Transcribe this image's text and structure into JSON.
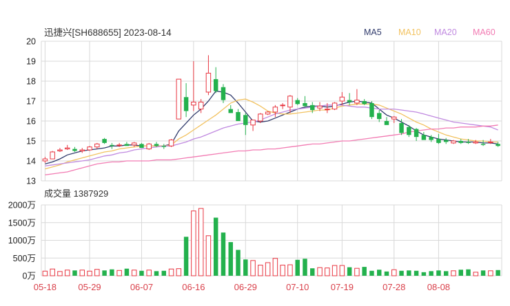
{
  "title": "迅捷兴[SH688655] 2023-08-14",
  "legend": [
    {
      "name": "MA5",
      "color": "#2f3a6b"
    },
    {
      "name": "MA10",
      "color": "#f2c260"
    },
    {
      "name": "MA20",
      "color": "#c089e0"
    },
    {
      "name": "MA60",
      "color": "#f27ab2"
    }
  ],
  "colors": {
    "up": "#e8343f",
    "down": "#23b14d",
    "grid": "#d8d8d8",
    "axis_text": "#222222",
    "date_text": "#d9404a",
    "vol_up_fill": "#ffffff"
  },
  "volume_label": "成交量 1387929",
  "chart_data": [
    {
      "type": "candlestick",
      "title": "迅捷兴[SH688655] 2023-08-14",
      "ylim": [
        13,
        20
      ],
      "yticks": [
        "13",
        "14",
        "15",
        "16",
        "17",
        "18",
        "19",
        "20"
      ],
      "x_tick_labels": [
        "05-18",
        "05-29",
        "06-07",
        "06-16",
        "06-29",
        "07-10",
        "07-19",
        "07-28",
        "08-08"
      ],
      "x_tick_index": [
        0,
        6,
        13,
        20,
        27,
        34,
        40,
        47,
        53
      ],
      "ohlc": [
        [
          14.0,
          14.2,
          13.9,
          14.1
        ],
        [
          14.1,
          14.5,
          14.1,
          14.45
        ],
        [
          14.5,
          14.65,
          14.45,
          14.55
        ],
        [
          14.6,
          14.8,
          14.55,
          14.65
        ],
        [
          14.6,
          14.7,
          14.45,
          14.5
        ],
        [
          14.5,
          14.65,
          14.4,
          14.55
        ],
        [
          14.55,
          14.75,
          14.5,
          14.7
        ],
        [
          14.7,
          14.9,
          14.6,
          14.85
        ],
        [
          15.1,
          15.15,
          14.85,
          14.9
        ],
        [
          14.8,
          14.9,
          14.6,
          14.75
        ],
        [
          14.8,
          14.9,
          14.7,
          14.8
        ],
        [
          14.85,
          14.95,
          14.75,
          14.75
        ],
        [
          14.8,
          14.95,
          14.7,
          14.9
        ],
        [
          14.85,
          14.9,
          14.65,
          14.65
        ],
        [
          14.6,
          14.9,
          14.55,
          14.85
        ],
        [
          14.85,
          14.95,
          14.7,
          14.75
        ],
        [
          14.75,
          14.85,
          14.6,
          14.7
        ],
        [
          14.75,
          15.1,
          14.7,
          15.05
        ],
        [
          16.1,
          18.1,
          16.1,
          18.1
        ],
        [
          17.2,
          17.9,
          16.2,
          16.5
        ],
        [
          16.8,
          19.0,
          16.5,
          16.95
        ],
        [
          16.6,
          17.1,
          16.4,
          16.95
        ],
        [
          17.45,
          19.3,
          17.3,
          18.4
        ],
        [
          18.1,
          18.7,
          17.4,
          17.5
        ],
        [
          17.7,
          17.85,
          16.9,
          17.05
        ],
        [
          16.6,
          16.8,
          16.4,
          16.4
        ],
        [
          16.45,
          16.6,
          16.0,
          16.0
        ],
        [
          16.3,
          16.4,
          15.3,
          15.8
        ],
        [
          15.8,
          16.0,
          15.5,
          16.05
        ],
        [
          16.0,
          16.4,
          15.9,
          16.35
        ],
        [
          16.35,
          16.5,
          16.3,
          16.45
        ],
        [
          16.45,
          16.8,
          16.2,
          16.7
        ],
        [
          16.8,
          16.9,
          16.6,
          16.8
        ],
        [
          16.7,
          17.3,
          16.4,
          17.25
        ],
        [
          17.05,
          17.15,
          16.8,
          16.85
        ],
        [
          16.9,
          17.25,
          16.7,
          16.75
        ],
        [
          16.8,
          16.95,
          16.4,
          16.55
        ],
        [
          16.65,
          16.95,
          16.5,
          16.75
        ],
        [
          16.6,
          16.9,
          16.4,
          16.6
        ],
        [
          16.6,
          16.95,
          16.55,
          16.9
        ],
        [
          17.0,
          17.45,
          16.8,
          17.2
        ],
        [
          17.05,
          17.4,
          16.8,
          16.95
        ],
        [
          16.9,
          17.6,
          16.8,
          17.05
        ],
        [
          17.0,
          17.1,
          16.8,
          16.85
        ],
        [
          16.9,
          17.0,
          16.1,
          16.2
        ],
        [
          16.4,
          16.55,
          15.95,
          16.1
        ],
        [
          16.0,
          16.2,
          15.8,
          15.8
        ],
        [
          16.1,
          16.25,
          15.9,
          16.2
        ],
        [
          15.9,
          16.1,
          15.3,
          15.4
        ],
        [
          15.7,
          15.8,
          15.2,
          15.3
        ],
        [
          15.6,
          15.65,
          15.0,
          15.2
        ],
        [
          15.3,
          15.45,
          15.05,
          15.05
        ],
        [
          15.2,
          15.3,
          14.95,
          15.05
        ],
        [
          15.1,
          15.35,
          14.85,
          14.9
        ],
        [
          15.05,
          15.15,
          14.85,
          14.95
        ],
        [
          14.9,
          15.05,
          14.85,
          15.0
        ],
        [
          15.0,
          15.1,
          14.85,
          14.9
        ],
        [
          14.95,
          15.1,
          14.85,
          14.9
        ],
        [
          14.9,
          15.05,
          14.85,
          14.95
        ],
        [
          14.85,
          15.05,
          14.75,
          14.8
        ],
        [
          14.95,
          15.1,
          14.85,
          14.95
        ],
        [
          14.85,
          14.95,
          14.7,
          14.75
        ]
      ],
      "ma": {
        "MA5": [
          13.85,
          13.95,
          14.1,
          14.3,
          14.4,
          14.5,
          14.55,
          14.6,
          14.65,
          14.75,
          14.75,
          14.8,
          14.8,
          14.75,
          14.75,
          14.75,
          14.75,
          14.85,
          15.5,
          15.9,
          16.3,
          16.6,
          17.0,
          17.5,
          17.45,
          17.3,
          16.9,
          16.45,
          16.0,
          15.95,
          16.0,
          16.15,
          16.3,
          16.45,
          16.6,
          16.7,
          16.75,
          16.75,
          16.7,
          16.75,
          16.85,
          16.95,
          17.0,
          16.95,
          16.9,
          16.6,
          16.3,
          16.15,
          15.95,
          15.75,
          15.5,
          15.3,
          15.2,
          15.1,
          15.05,
          15.0,
          14.95,
          14.95,
          14.95,
          14.9,
          14.9,
          14.85
        ],
        "MA10": [
          13.6,
          13.7,
          13.8,
          13.95,
          14.05,
          14.15,
          14.25,
          14.35,
          14.45,
          14.5,
          14.6,
          14.65,
          14.7,
          14.75,
          14.75,
          14.75,
          14.75,
          14.8,
          15.1,
          15.3,
          15.55,
          15.8,
          16.05,
          16.3,
          16.6,
          16.9,
          17.05,
          17.1,
          16.95,
          16.75,
          16.5,
          16.4,
          16.35,
          16.35,
          16.4,
          16.45,
          16.5,
          16.55,
          16.55,
          16.65,
          16.75,
          16.8,
          16.85,
          16.85,
          16.85,
          16.8,
          16.65,
          16.5,
          16.35,
          16.15,
          15.95,
          15.8,
          15.6,
          15.45,
          15.3,
          15.2,
          15.1,
          15.05,
          15.0,
          15.0,
          14.95,
          14.95
        ],
        "MA20": [
          13.75,
          13.8,
          13.85,
          13.9,
          13.95,
          14.0,
          14.05,
          14.15,
          14.25,
          14.3,
          14.4,
          14.45,
          14.55,
          14.6,
          14.65,
          14.7,
          14.75,
          14.75,
          14.85,
          14.95,
          15.1,
          15.2,
          15.35,
          15.5,
          15.65,
          15.75,
          15.85,
          15.9,
          15.95,
          16.05,
          16.2,
          16.35,
          16.45,
          16.55,
          16.6,
          16.65,
          16.7,
          16.75,
          16.8,
          16.8,
          16.8,
          16.75,
          16.7,
          16.7,
          16.65,
          16.6,
          16.6,
          16.6,
          16.55,
          16.5,
          16.45,
          16.35,
          16.25,
          16.15,
          16.05,
          15.95,
          15.9,
          15.85,
          15.8,
          15.75,
          15.7,
          15.55
        ],
        "MA60": [
          13.3,
          13.35,
          13.4,
          13.45,
          13.55,
          13.65,
          13.75,
          13.85,
          13.9,
          13.95,
          13.95,
          14.0,
          14.0,
          14.0,
          14.0,
          14.05,
          14.05,
          14.05,
          14.1,
          14.15,
          14.2,
          14.25,
          14.3,
          14.35,
          14.4,
          14.45,
          14.5,
          14.5,
          14.55,
          14.55,
          14.6,
          14.6,
          14.65,
          14.7,
          14.75,
          14.8,
          14.85,
          14.85,
          14.9,
          14.95,
          15.0,
          15.0,
          15.05,
          15.1,
          15.15,
          15.2,
          15.25,
          15.3,
          15.35,
          15.45,
          15.5,
          15.55,
          15.6,
          15.6,
          15.65,
          15.65,
          15.7,
          15.7,
          15.7,
          15.75,
          15.75,
          15.8
        ]
      }
    },
    {
      "type": "bar",
      "title": "成交量 1387929",
      "ylim": [
        0,
        2000
      ],
      "yticks": [
        "0万",
        "500万",
        "1000万",
        "1500万",
        "2000万"
      ],
      "unit": "万",
      "values": [
        130,
        190,
        120,
        160,
        150,
        160,
        130,
        180,
        150,
        180,
        150,
        200,
        160,
        140,
        160,
        130,
        140,
        190,
        200,
        1100,
        1830,
        1900,
        1130,
        1640,
        1220,
        950,
        730,
        460,
        430,
        300,
        370,
        490,
        300,
        310,
        450,
        480,
        210,
        230,
        220,
        290,
        290,
        240,
        210,
        250,
        140,
        170,
        120,
        170,
        140,
        150,
        140,
        100,
        130,
        150,
        130,
        140,
        170,
        180,
        100,
        150,
        140,
        160
      ]
    }
  ]
}
